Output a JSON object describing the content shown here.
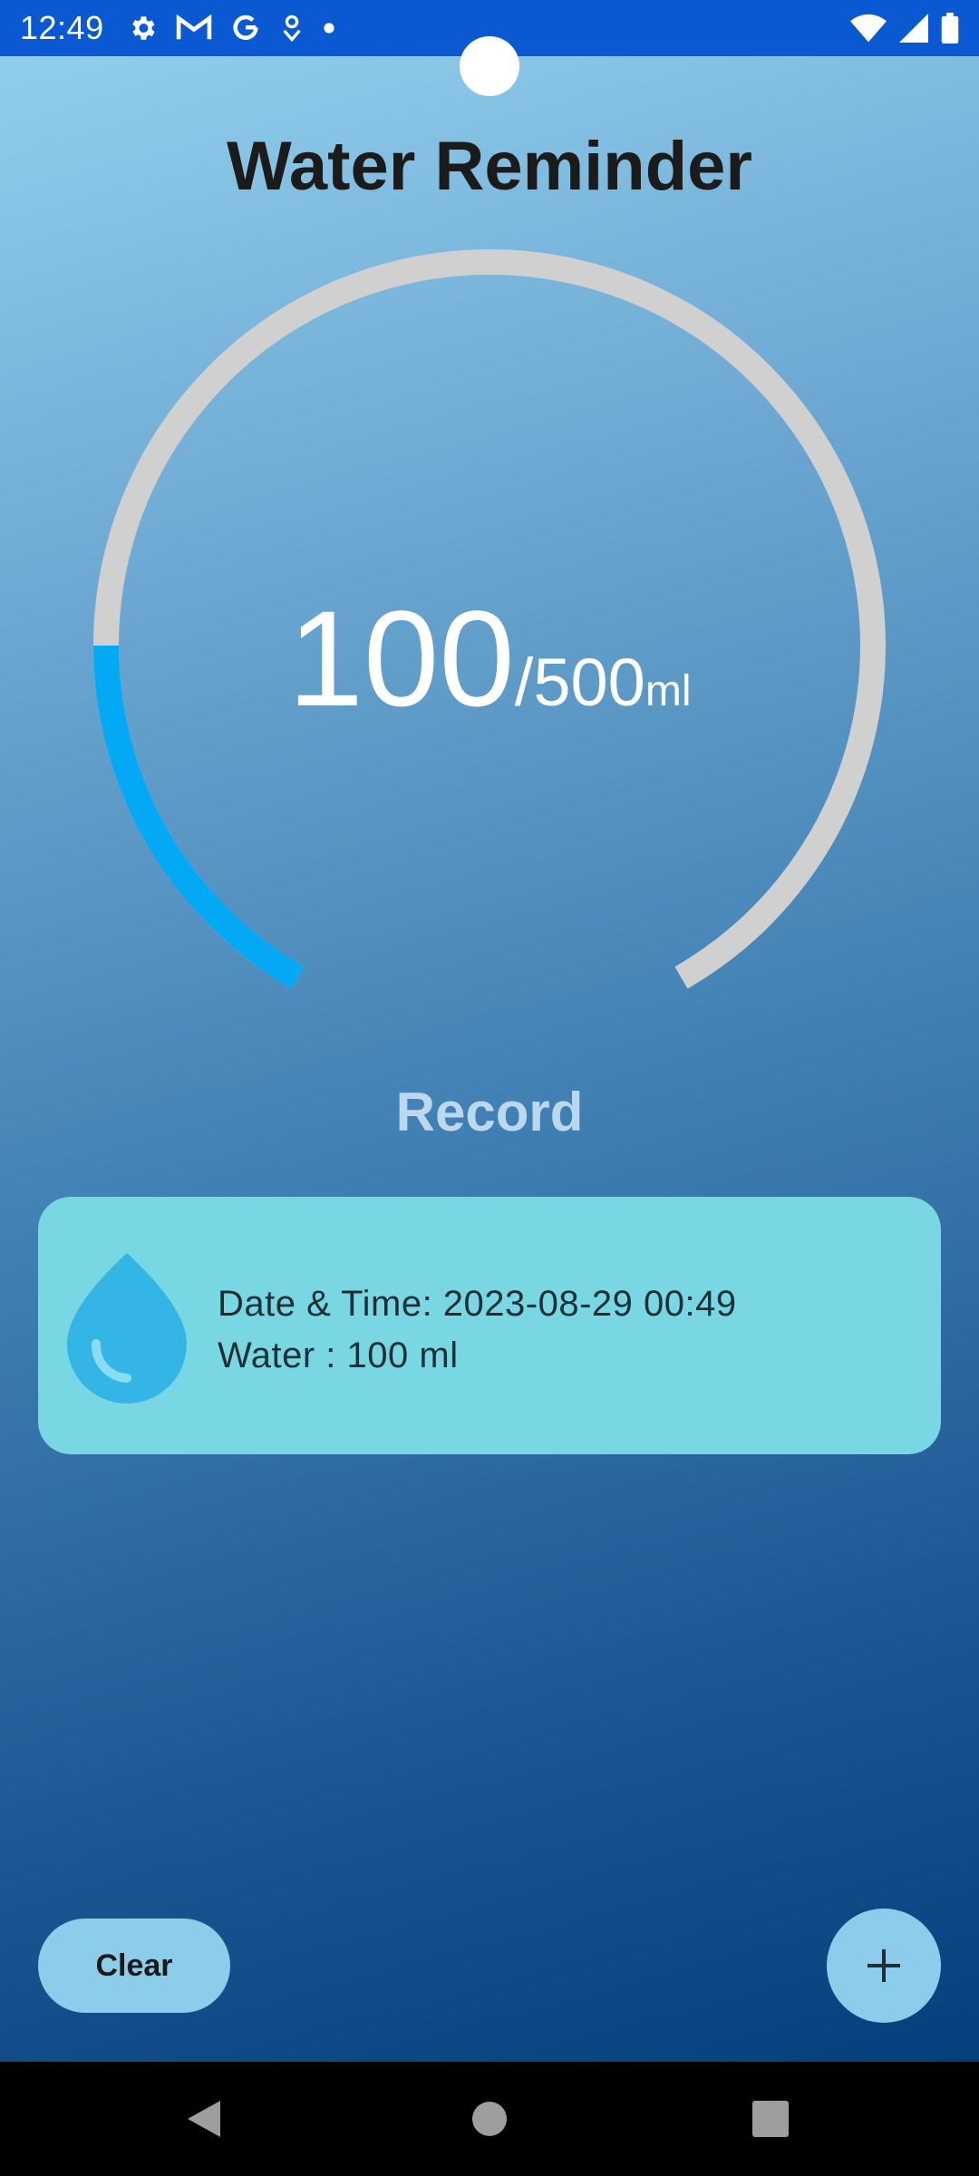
{
  "status_bar": {
    "time": "12:49",
    "left_icons": [
      "settings-icon",
      "gmail-icon",
      "google-icon",
      "location-pin-icon",
      "dot-icon"
    ],
    "right_icons": [
      "wifi-icon",
      "signal-icon",
      "battery-icon"
    ]
  },
  "app": {
    "title": "Water Reminder",
    "progress": {
      "current": "100",
      "total": "/500",
      "unit": "ml",
      "fraction": 0.2,
      "track_color": "#d0d0d0",
      "fill_color": "#03a9f4"
    },
    "record_title": "Record",
    "records": [
      {
        "icon": "water-drop-icon",
        "datetime_line": "Date & Time: 2023-08-29 00:49",
        "water_line": "Water : 100 ml"
      }
    ],
    "clear_label": "Clear",
    "add_icon": "plus-icon"
  },
  "nav_bar": {
    "buttons": [
      "back-icon",
      "home-icon",
      "recents-icon"
    ]
  }
}
